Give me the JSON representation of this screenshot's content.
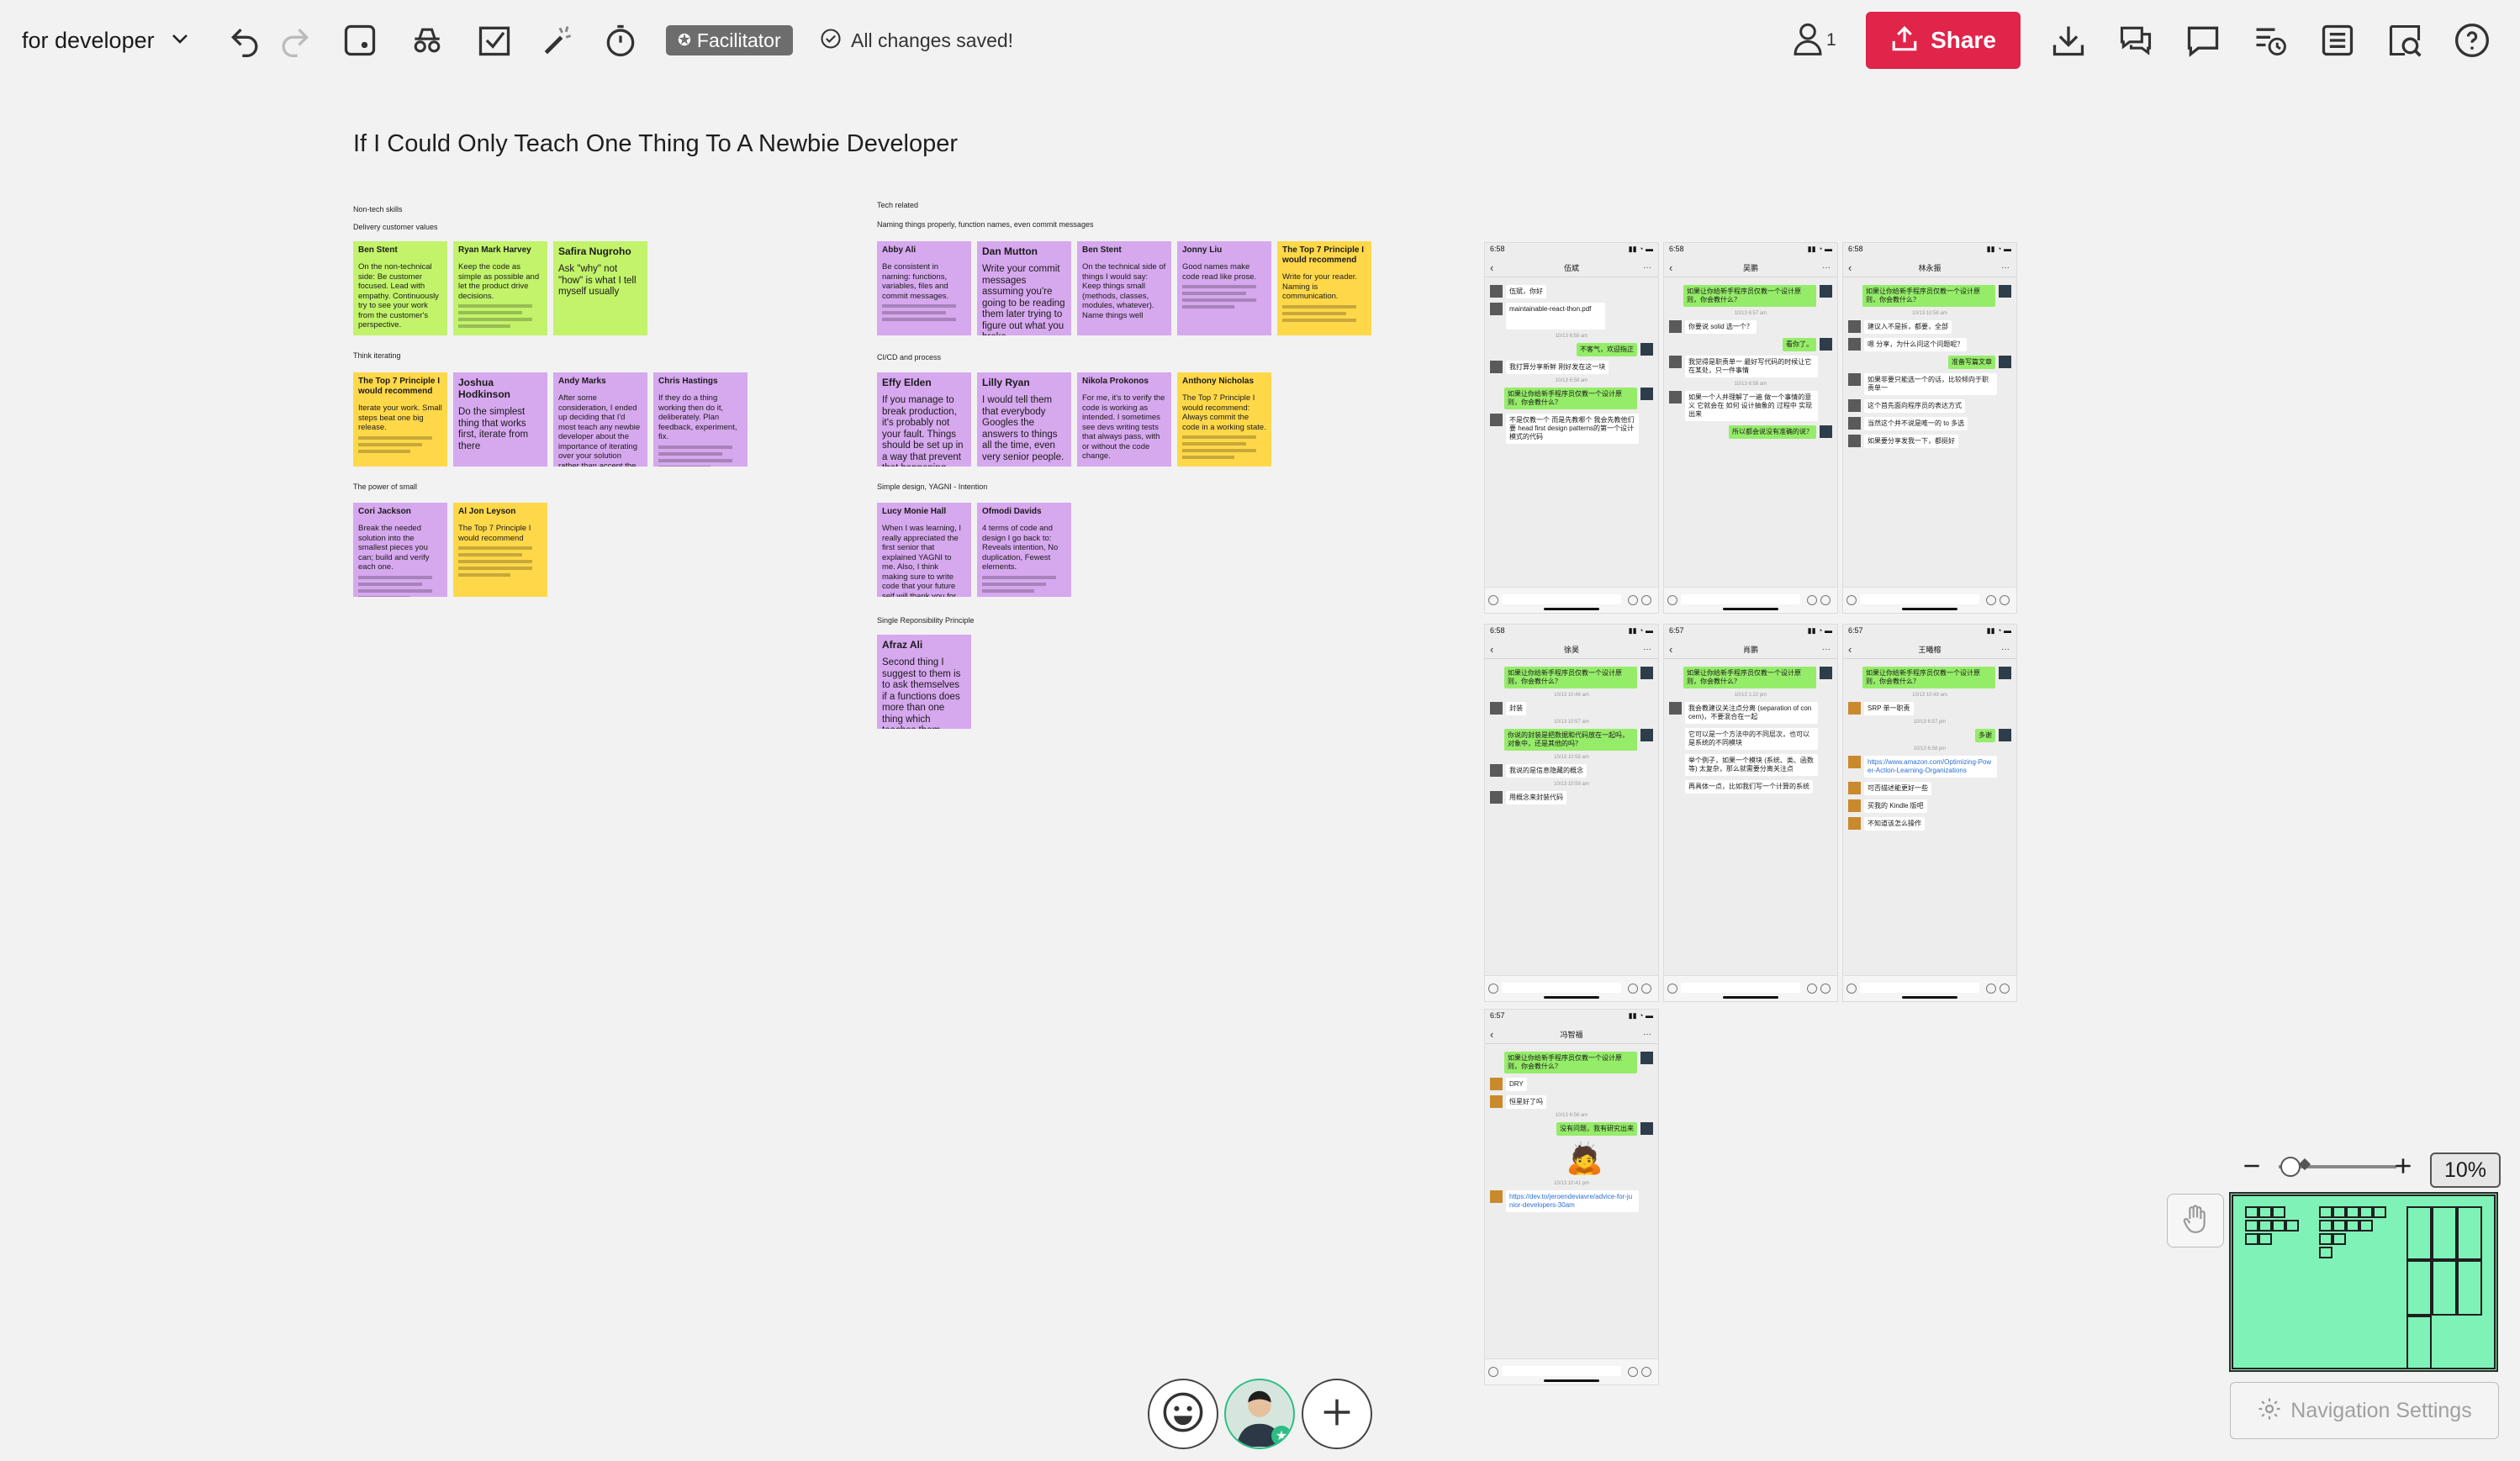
{
  "toolbar": {
    "board_name": "for developer",
    "facilitator_label": "Facilitator",
    "save_status": "All changes saved!",
    "share_label": "Share",
    "collaborator_count": "1",
    "accent_color": "#e0244a"
  },
  "board": {
    "title": "If I Could Only Teach One Thing To A Newbie Developer",
    "sections": [
      "Non-tech skills",
      "Delivery customer values",
      "Think iterating",
      "The power of small",
      "Tech related",
      "Naming things properly, function names, even commit messages",
      "CI/CD and process",
      "Simple design, YAGNI - Intention",
      "Single Reponsibility Principle"
    ],
    "notes": [
      {
        "author": "Ben Stent",
        "body": "On the non-technical side: Be customer focused. Lead with empathy. Continuously try to see your work from the customer's perspective."
      },
      {
        "author": "Ryan Mark Harvey",
        "body": "Keep the code as simple as possible and let the product drive decisions."
      },
      {
        "author": "Safira Nugroho",
        "body": "Ask \"why\" not \"how\" is what I tell myself usually"
      },
      {
        "author": "The Top 7 Principle I would recommend",
        "body": "Iterate your work. Small steps beat one big release."
      },
      {
        "author": "Joshua Hodkinson",
        "body": "Do the simplest thing that works first, iterate from there"
      },
      {
        "author": "Andy Marks",
        "body": "After some consideration, I ended up deciding that I'd most teach any newbie developer about the importance of iterating over your solution rather than accept the first thing that compiled, I would be quite happy"
      },
      {
        "author": "Chris Hastings",
        "body": "If they do a thing working then do it, deliberately. Plan feedback, experiment, fix."
      },
      {
        "author": "Cori Jackson",
        "body": "Break the needed solution into the smallest pieces you can; build and verify each one."
      },
      {
        "author": "Al Jon Leyson",
        "body": "The Top 7 Principle I would recommend"
      },
      {
        "author": "Abby Ali",
        "body": "Be consistent in naming: functions, variables, files and commit messages."
      },
      {
        "author": "Dan Mutton",
        "body": "Write your commit messages assuming you're going to be reading them later trying to figure out what you broke"
      },
      {
        "author": "Ben Stent",
        "body": "On the technical side of things I would say: Keep things small (methods, classes, modules, whatever). Name things well"
      },
      {
        "author": "Jonny Liu",
        "body": "Good names make code read like prose."
      },
      {
        "author": "The Top 7 Principle I would recommend",
        "body": "Write for your reader. Naming is communication."
      },
      {
        "author": "Effy Elden",
        "body": "If you manage to break production, it's probably not your fault. Things should be set up in a way that prevent that happening."
      },
      {
        "author": "Lilly Ryan",
        "body": "I would tell them that everybody Googles the answers to things all the time, even very senior people."
      },
      {
        "author": "Nikola Prokonos",
        "body": "For me, it's to verify the code is working as intended. I sometimes see devs writing tests that always pass, with or without the code change."
      },
      {
        "author": "Anthony Nicholas",
        "body": "The Top 7 Principle I would recommend: Always commit the code in a working state."
      },
      {
        "author": "Lucy Monie Hall",
        "body": "When I was learning, I really appreciated the first senior that explained YAGNI to me. Also, I think making sure to write code that your future self will thank you for (simple, clear, well named etc)."
      },
      {
        "author": "Ofmodi Davids",
        "body": "4 terms of code and design I go back to: Reveals intention, No duplication, Fewest elements."
      },
      {
        "author": "Afraz Ali",
        "body": "Second thing I suggest to them is to ask themselves if a functions does more than one thing which teaches them about SRP."
      }
    ]
  },
  "chats": [
    {
      "contact": "伍斌",
      "time": "6:58",
      "messages": [
        {
          "side": "them",
          "text": "伍斌，你好"
        },
        {
          "side": "them",
          "text": "maintainable-react-thon.pdf"
        },
        {
          "side": "me",
          "text": "不客气，欢迎指正"
        },
        {
          "side": "them",
          "text": "我打算分享新鲜 刚好发在这一块"
        },
        {
          "side": "me",
          "text": "如果让你给新手程序员仅教一个设计原则，你会教什么？"
        },
        {
          "side": "them",
          "text": "不是仅教一个 而是先教哪个 我会先教他们要 head first design patterns的第一个设计模式的代码"
        }
      ]
    },
    {
      "contact": "吴鹏",
      "time": "6:58",
      "messages": [
        {
          "side": "me",
          "text": "如果让你给新手程序员仅教一个设计原则，你会教什么？"
        },
        {
          "side": "them",
          "text": "你要说 solid 选一个？"
        },
        {
          "side": "me",
          "text": "看你了。"
        },
        {
          "side": "them",
          "text": "我觉得是职责单一 最好写代码的时候让它在某处，只一件事情"
        },
        {
          "side": "them",
          "text": "如果一个人并理解了一遍 做一个事情的意义 它就会在 如何 设计抽象的 过程中 实现出来"
        },
        {
          "side": "me",
          "text": "所以都会说没有准确的说？"
        }
      ]
    },
    {
      "contact": "林永振",
      "time": "6:58",
      "messages": [
        {
          "side": "me",
          "text": "如果让你给新手程序员仅教一个设计原则，你会教什么？"
        },
        {
          "side": "them",
          "text": "建议入不是拆，都要，全部"
        },
        {
          "side": "them",
          "text": "嗯 分享，为什么问这个问题呢？"
        },
        {
          "side": "me",
          "text": "准备写篇文章"
        },
        {
          "side": "them",
          "text": "如果非要只能选一个的话，比较倾向于职责单一"
        },
        {
          "side": "them",
          "text": "这个首先面向程序员的表达方式"
        },
        {
          "side": "them",
          "text": "当然这个并不说是唯一的 to 多选"
        },
        {
          "side": "them",
          "text": "如果要分享发我一下，都挺好"
        }
      ]
    },
    {
      "contact": "徐昊",
      "time": "6:58",
      "messages": [
        {
          "side": "me",
          "text": "如果让你给新手程序员仅教一个设计原则，你会教什么？"
        },
        {
          "side": "them",
          "text": "封装"
        },
        {
          "side": "me",
          "text": "你说的封装是把数据和代码放在一起吗，对象中，还是其他的吗？"
        },
        {
          "side": "them",
          "text": "我说的是信息隐藏的概念"
        },
        {
          "side": "them",
          "text": "用概念来封装代码"
        }
      ]
    },
    {
      "contact": "肖鹏",
      "time": "6:57",
      "messages": [
        {
          "side": "me",
          "text": "如果让你给新手程序员仅教一个设计原则，你会教什么？"
        },
        {
          "side": "them",
          "text": "我会教建议关注点分离 (separation of concern)，不要混合在一起"
        },
        {
          "side": "them",
          "text": "它可以是一个方法中的不同层次，也可以是系统的不同模块"
        },
        {
          "side": "them",
          "text": "举个例子，如果一个模块 (系统、类、函数等) 太复杂，那么就需要分离关注点"
        },
        {
          "side": "them",
          "text": "再具体一点，比如我们写一个计算的系统"
        }
      ]
    },
    {
      "contact": "王曦榕",
      "time": "6:57",
      "messages": [
        {
          "side": "me",
          "text": "如果让你给新手程序员仅教一个设计原则，你会教什么？"
        },
        {
          "side": "them",
          "text": "SRP 单一职责"
        },
        {
          "side": "me",
          "text": "多谢"
        },
        {
          "side": "them",
          "text": "https://www.amazon.com/Optimizing-Power-Action-Learning-Organizations"
        },
        {
          "side": "them",
          "text": "可否描述能更好一些"
        },
        {
          "side": "them",
          "text": "买我的 Kindle 版吧"
        },
        {
          "side": "them",
          "text": "不知道该怎么操作"
        }
      ]
    },
    {
      "contact": "冯智福",
      "time": "6:57",
      "messages": [
        {
          "side": "me",
          "text": "如果让你给新手程序员仅教一个设计原则，你会教什么？"
        },
        {
          "side": "them",
          "text": "DRY"
        },
        {
          "side": "them",
          "text": "恒星好了吗"
        },
        {
          "side": "me",
          "text": "没有问题，我有研究出来"
        },
        {
          "side": "them",
          "text": "https://dev.to/jeroendeviavre/advice-for-junior-developers-30am"
        }
      ]
    }
  ],
  "bottom": {
    "zoom": "10%",
    "nav_settings_label": "Navigation Settings"
  }
}
